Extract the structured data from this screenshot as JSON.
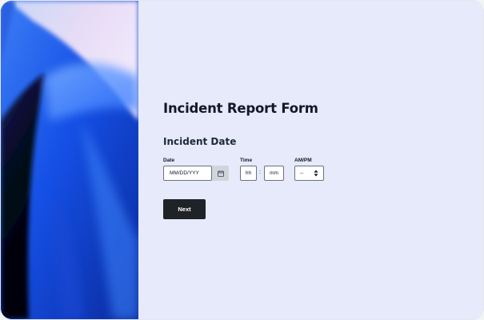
{
  "form": {
    "title": "Incident Report Form",
    "section_title": "Incident Date",
    "date": {
      "label": "Date",
      "placeholder": "MM/DD/YYY",
      "icon": "calendar-icon"
    },
    "time": {
      "label": "Time",
      "hours_placeholder": "hh",
      "minutes_placeholder": "mm",
      "separator": ":"
    },
    "ampm": {
      "label": "AM/PM",
      "selected": "--",
      "icon": "sort-arrows-icon"
    },
    "next_label": "Next"
  },
  "colors": {
    "panel_background": "#e6eafb",
    "button_dark": "#1f2226",
    "hero_blue": "#1d6cf2"
  }
}
